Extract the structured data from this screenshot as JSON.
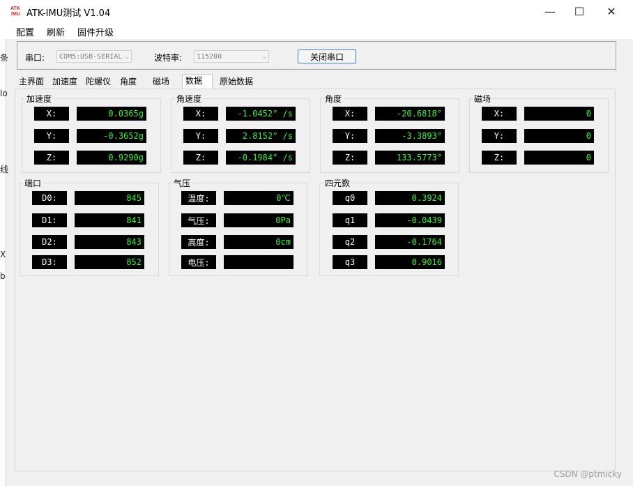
{
  "window": {
    "title": "ATK-IMU测试 V1.04",
    "minimize": "—",
    "maximize": "☐",
    "close": "✕"
  },
  "menu": [
    "配置",
    "刷新",
    "固件升级"
  ],
  "edge_fragments": [
    "条",
    "lo",
    "线",
    "X",
    "b"
  ],
  "serial": {
    "port_label": "串口:",
    "port_value": "COM5:USB-SERIAL",
    "baud_label": "波特率:",
    "baud_value": "115200",
    "close_button": "关闭串口"
  },
  "tabs": [
    "主界面",
    "加速度",
    "陀螺仪",
    "角度",
    "磁场",
    "数据",
    "原始数据"
  ],
  "active_tab": "数据",
  "groups": {
    "accel": {
      "title": "加速度",
      "rows": [
        {
          "k": "X:",
          "v": "0.0365g"
        },
        {
          "k": "Y:",
          "v": "-0.3652g"
        },
        {
          "k": "Z:",
          "v": "0.9290g"
        }
      ]
    },
    "gyro": {
      "title": "角速度",
      "rows": [
        {
          "k": "X:",
          "v": "-1.0452° /s"
        },
        {
          "k": "Y:",
          "v": "2.8152° /s"
        },
        {
          "k": "Z:",
          "v": "-0.1984° /s"
        }
      ]
    },
    "angle": {
      "title": "角度",
      "rows": [
        {
          "k": "X:",
          "v": "-20.6818°"
        },
        {
          "k": "Y:",
          "v": "-3.3893°"
        },
        {
          "k": "Z:",
          "v": "133.5773°"
        }
      ]
    },
    "mag": {
      "title": "磁场",
      "rows": [
        {
          "k": "X:",
          "v": "0"
        },
        {
          "k": "Y:",
          "v": "0"
        },
        {
          "k": "Z:",
          "v": "0"
        }
      ]
    },
    "port": {
      "title": "端口",
      "rows": [
        {
          "k": "D0:",
          "v": "845"
        },
        {
          "k": "D1:",
          "v": "841"
        },
        {
          "k": "D2:",
          "v": "843"
        },
        {
          "k": "D3:",
          "v": "852"
        }
      ]
    },
    "pressure": {
      "title": "气压",
      "rows": [
        {
          "k": "温度:",
          "v": "0℃"
        },
        {
          "k": "气压:",
          "v": "0Pa"
        },
        {
          "k": "高度:",
          "v": "0cm"
        },
        {
          "k": "电压:",
          "v": ""
        }
      ]
    },
    "quat": {
      "title": "四元数",
      "rows": [
        {
          "k": "q0",
          "v": "0.3924"
        },
        {
          "k": "q1",
          "v": "-0.0439"
        },
        {
          "k": "q2",
          "v": "-0.1764"
        },
        {
          "k": "q3",
          "v": "0.9016"
        }
      ]
    }
  },
  "watermark": "CSDN @ptmicky",
  "colors": {
    "value_text": "#3ef03e",
    "readout_bg": "#000000",
    "button_border": "#3a7ed4"
  }
}
